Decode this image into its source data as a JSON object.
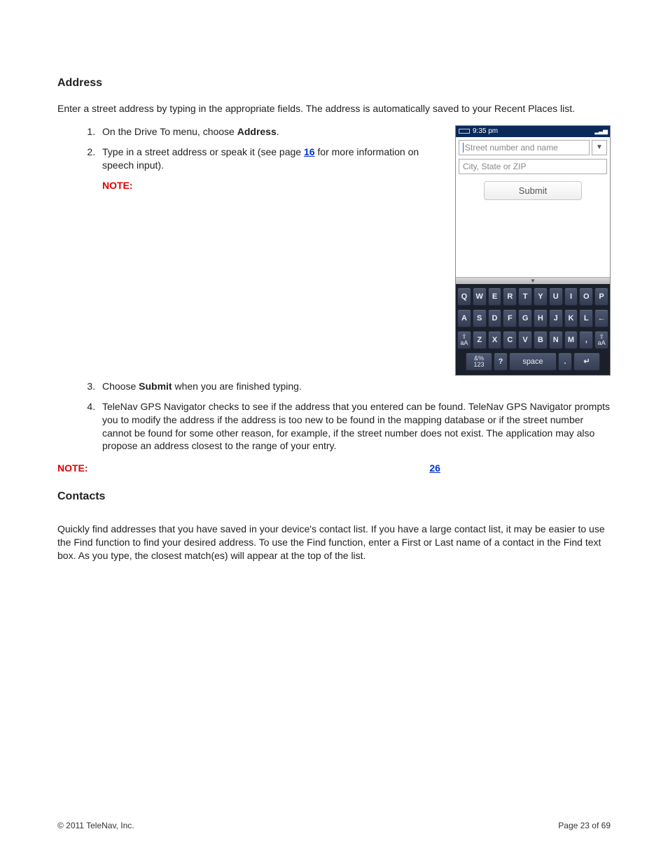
{
  "sections": {
    "address": {
      "heading": "Address",
      "intro": "Enter a street address by typing in the appropriate fields. The address is automatically saved to your Recent Places list.",
      "step1_a": "On the Drive To menu, choose ",
      "step1_b": "Address",
      "step1_c": ".",
      "step2_a": "Type in a street address or speak it (see page ",
      "step2_link": "16",
      "step2_b": " for more information on speech input).",
      "step2_note": "NOTE:",
      "step3_a": "Choose ",
      "step3_b": "Submit",
      "step3_c": " when you are finished typing.",
      "step4": "TeleNav GPS Navigator checks to see if the address that you entered can be found. TeleNav GPS Navigator prompts you to modify the address if the address is too new to be found in the mapping database or if the street number cannot be found for some other reason, for example, if the street number does not exist. The application may also propose an address closest to the range of your entry.",
      "bottom_note_label": "NOTE:",
      "bottom_note_link": "26"
    },
    "contacts": {
      "heading": "Contacts",
      "body": "Quickly find addresses that you have saved in your device's contact list. If you have a large contact list, it may be easier to use the Find function to find your desired address. To use the Find function, enter a First or Last name of a contact in the Find text box. As you type, the closest match(es) will appear at the top of the list."
    }
  },
  "phone": {
    "time": "9:35 pm",
    "street_placeholder": "Street number and name",
    "city_placeholder": "City, State or ZIP",
    "submit_label": "Submit",
    "dropdown_glyph": "▼",
    "kb_tab_glyph": "▼",
    "keyboard": {
      "row1": [
        "Q",
        "W",
        "E",
        "R",
        "T",
        "Y",
        "U",
        "I",
        "O",
        "P"
      ],
      "row2": [
        "A",
        "S",
        "D",
        "F",
        "G",
        "H",
        "J",
        "K",
        "L",
        "←"
      ],
      "row3_shift": "⇧",
      "row3_shift_sub": "aA",
      "row3": [
        "Z",
        "X",
        "C",
        "V",
        "B",
        "N",
        "M",
        ","
      ],
      "row4_sym1": "&%",
      "row4_sym2": "123",
      "row4_q": "?",
      "row4_space": "space",
      "row4_dot": ".",
      "row4_enter": "↵"
    }
  },
  "footer": {
    "copyright": "© 2011 TeleNav, Inc.",
    "page": "Page 23 of 69"
  }
}
